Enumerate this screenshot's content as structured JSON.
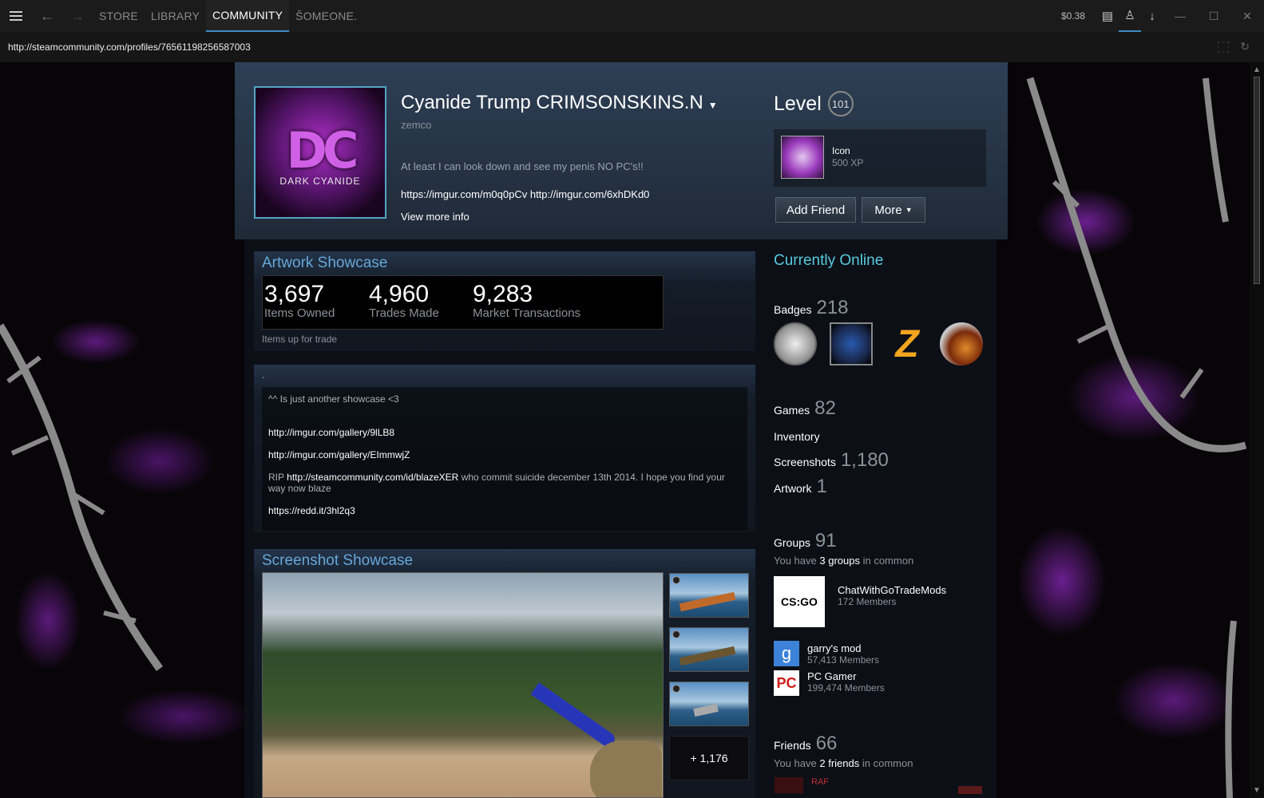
{
  "topbar": {
    "nav_tabs": [
      "STORE",
      "LIBRARY",
      "COMMUNITY",
      "ŠOMEONE."
    ],
    "active_tab": "COMMUNITY",
    "wallet": "$0.38"
  },
  "urlbar": {
    "url": "http://steamcommunity.com/profiles/76561198256587003"
  },
  "profile": {
    "avatar_text": "DC",
    "avatar_subtext": "DARK CYANIDE",
    "persona_name": "Cyanide Trump CRIMSONSKINS.N",
    "real_name": "zemco",
    "summary": "At least I can look down and see my penis NO PC's!!",
    "links": "https://imgur.com/m0q0pCv http://imgur.com/6xhDKd0",
    "view_more": "View more info",
    "level_label": "Level",
    "level": "101",
    "fav_badge": {
      "name": "Icon",
      "xp": "500 XP"
    },
    "add_friend_label": "Add Friend",
    "more_label": "More"
  },
  "artwork_showcase": {
    "title": "Artwork Showcase",
    "stats": [
      {
        "value": "3,697",
        "label": "Items Owned"
      },
      {
        "value": "4,960",
        "label": "Trades Made"
      },
      {
        "value": "9,283",
        "label": "Market Transactions"
      }
    ],
    "trade_text": "Items up for trade"
  },
  "custom_box": {
    "title": ".",
    "line1": "^^ Is just another showcase <3",
    "link1": "http://imgur.com/gallery/9lLB8",
    "link2": "http://imgur.com/gallery/EImmwjZ",
    "rip_prefix": "RIP",
    "rip_link": "http://steamcommunity.com/id/blazeXER",
    "rip_text": "who commit suicide december 13th 2014. I hope you find your way now blaze",
    "link3": "https://redd.it/3hl2q3"
  },
  "screenshot_showcase": {
    "title": "Screenshot Showcase",
    "more_count": "+ 1,176"
  },
  "sidebar": {
    "status": "Currently Online",
    "badges_label": "Badges",
    "badges_count": "218",
    "games_label": "Games",
    "games_count": "82",
    "inventory_label": "Inventory",
    "screenshots_label": "Screenshots",
    "screenshots_count": "1,180",
    "artwork_label": "Artwork",
    "artwork_count": "1",
    "groups_label": "Groups",
    "groups_count": "91",
    "groups_common_prefix": "You have",
    "groups_common_bold": "3 groups",
    "groups_common_suffix": "in common",
    "groups": [
      {
        "name": "ChatWithGoTradeMods",
        "members": "172 Members",
        "logo": "CS:GO"
      },
      {
        "name": "garry's mod",
        "members": "57,413 Members",
        "logo": "g"
      },
      {
        "name": "PC Gamer",
        "members": "199,474 Members",
        "logo": "PC"
      }
    ],
    "friends_label": "Friends",
    "friends_count": "66",
    "friends_common_prefix": "You have",
    "friends_common_bold": "2 friends",
    "friends_common_suffix": "in common",
    "friend_partial": "RAF"
  },
  "colors": {
    "accent_blue": "#66a7d8",
    "online": "#57cbde",
    "tab_underline": "#3d8cc4"
  }
}
